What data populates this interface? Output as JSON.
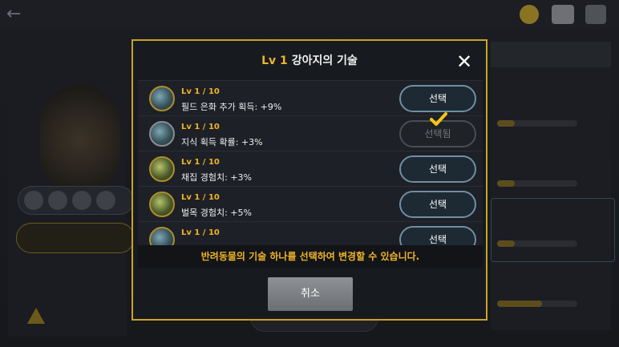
{
  "modal": {
    "title_level": "Lv 1",
    "title_text": "강아지의 기술",
    "close_icon": "close-icon",
    "notice": "반려동물의 기술 하나를 선택하여 변경할 수 있습니다.",
    "cancel_label": "취소"
  },
  "skills": [
    {
      "level": "Lv 1 / 10",
      "desc": "필드 은화 추가 획득: +9%",
      "button": "선택",
      "state": "available",
      "icon": "silver-coin-skill-icon"
    },
    {
      "level": "Lv 1 / 10",
      "desc": "지식 획득 확률: +3%",
      "button": "선택됨",
      "state": "selected",
      "icon": "book-skill-icon"
    },
    {
      "level": "Lv 1 / 10",
      "desc": "채집 경험치: +3%",
      "button": "선택",
      "state": "available",
      "icon": "gathering-skill-icon"
    },
    {
      "level": "Lv 1 / 10",
      "desc": "벌목 경험치: +5%",
      "button": "선택",
      "state": "available",
      "icon": "logging-skill-icon"
    },
    {
      "level": "Lv 1 / 10",
      "desc": "",
      "button": "선택",
      "state": "available",
      "icon": "skill-icon"
    }
  ],
  "colors": {
    "accent": "#f0b429",
    "modal_border": "#c9a227",
    "button_border": "#6f8fa5",
    "check": "#f5c518"
  }
}
